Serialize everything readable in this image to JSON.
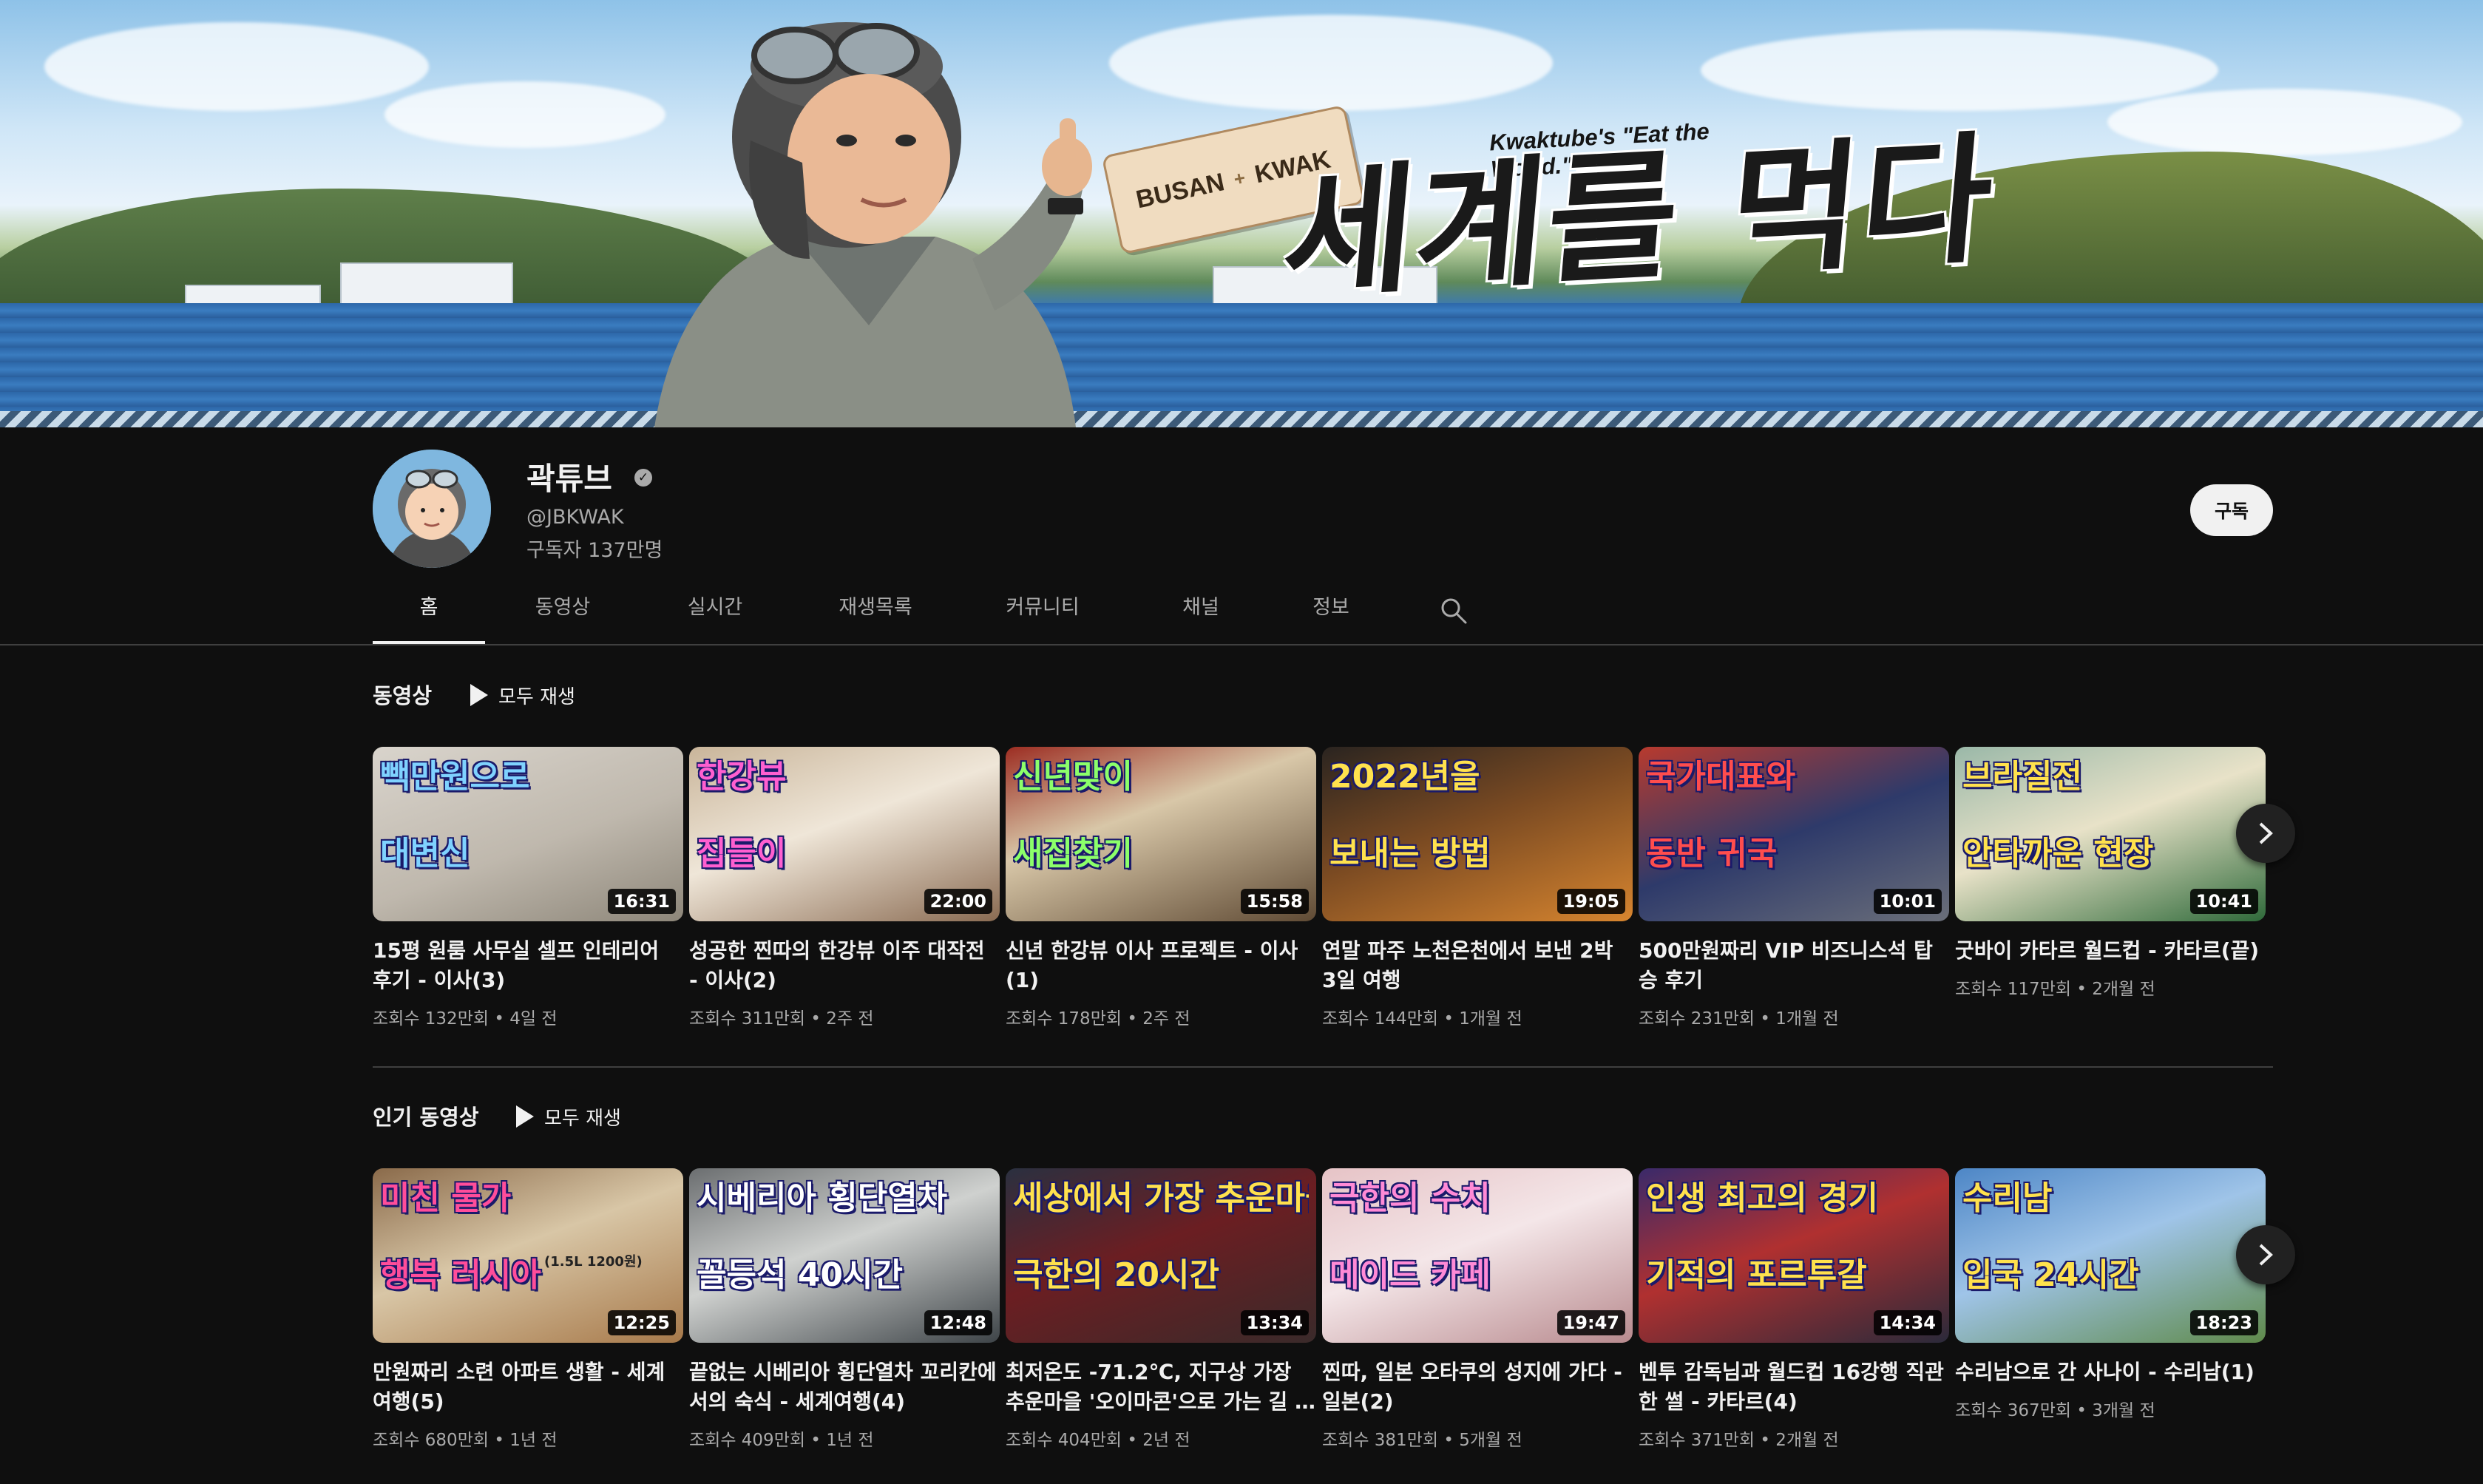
{
  "banner": {
    "tag_left": "BUSAN",
    "tag_plus": "+",
    "tag_right": "KWAK",
    "slogan": "Kwaktube's \"Eat the World.\"",
    "title": "세계를 먹다"
  },
  "channel": {
    "name": "곽튜브",
    "handle": "@JBKWAK",
    "subscribers": "구독자 137만명",
    "subscribe_label": "구독",
    "verified_glyph": "✓"
  },
  "tabs": [
    "홈",
    "동영상",
    "실시간",
    "재생목록",
    "커뮤니티",
    "채널",
    "정보"
  ],
  "sections": [
    {
      "title": "동영상",
      "play_all": "모두 재생",
      "videos": [
        {
          "title": "15평 원룸 사무실 셀프 인테리어 후기 - 이사(3)",
          "views": "조회수 132만회",
          "age": "4일 전",
          "duration": "16:31",
          "overlay": [
            "빽만원으로",
            "대변신"
          ]
        },
        {
          "title": "성공한 찐따의 한강뷰 이주 대작전 - 이사(2)",
          "views": "조회수 311만회",
          "age": "2주 전",
          "duration": "22:00",
          "overlay": [
            "한강뷰",
            "집들이"
          ]
        },
        {
          "title": "신년 한강뷰 이사 프로젝트 - 이사(1)",
          "views": "조회수 178만회",
          "age": "2주 전",
          "duration": "15:58",
          "overlay": [
            "신년맞이",
            "새집찾기"
          ]
        },
        {
          "title": "연말 파주 노천온천에서 보낸 2박 3일 여행",
          "views": "조회수 144만회",
          "age": "1개월 전",
          "duration": "19:05",
          "overlay": [
            "2022년을",
            "보내는 방법"
          ]
        },
        {
          "title": "500만원짜리 VIP 비즈니스석 탑승 후기",
          "views": "조회수 231만회",
          "age": "1개월 전",
          "duration": "10:01",
          "overlay": [
            "국가대표와",
            "동반 귀국"
          ]
        },
        {
          "title": "굿바이 카타르 월드컵 - 카타르(끝)",
          "views": "조회수 117만회",
          "age": "2개월 전",
          "duration": "10:41",
          "overlay": [
            "브라질전",
            "안타까운 현장"
          ]
        }
      ]
    },
    {
      "title": "인기 동영상",
      "play_all": "모두 재생",
      "videos": [
        {
          "title": "만원짜리 소련 아파트 생활 - 세계여행(5)",
          "views": "조회수 680만회",
          "age": "1년 전",
          "duration": "12:25",
          "overlay": [
            "미친 물가",
            "행복 러시아"
          ],
          "extra": "(1.5L 1200원)"
        },
        {
          "title": "끝없는 시베리아 횡단열차 꼬리칸에서의 숙식 - 세계여행(4)",
          "views": "조회수 409만회",
          "age": "1년 전",
          "duration": "12:48",
          "overlay": [
            "시베리아 횡단열차",
            "꼴등석 40시간"
          ]
        },
        {
          "title": "최저온도 -71.2℃, 지구상 가장 추운마을 '오이마콘'으로 가는 길 - ...",
          "views": "조회수 404만회",
          "age": "2년 전",
          "duration": "13:34",
          "overlay": [
            "세상에서 가장 추운마을",
            "극한의 20시간"
          ]
        },
        {
          "title": "찐따, 일본 오타쿠의 성지에 가다 - 일본(2)",
          "views": "조회수 381만회",
          "age": "5개월 전",
          "duration": "19:47",
          "overlay": [
            "극한의 수치",
            "메이드 카페"
          ]
        },
        {
          "title": "벤투 감독님과 월드컵 16강행 직관한 썰 - 카타르(4)",
          "views": "조회수 371만회",
          "age": "2개월 전",
          "duration": "14:34",
          "overlay": [
            "인생 최고의 경기",
            "기적의 포르투갈"
          ]
        },
        {
          "title": "수리남으로 간 사나이 - 수리남(1)",
          "views": "조회수 367만회",
          "age": "3개월 전",
          "duration": "18:23",
          "overlay": [
            "수리남",
            "입국 24시간"
          ]
        }
      ]
    }
  ],
  "meta_separator": "•",
  "colors": {
    "background": "#0f0f0f",
    "text_primary": "#f1f1f1",
    "text_secondary": "#aaaaaa",
    "divider": "#3f3f3f",
    "subscribe_bg": "#f1f1f1"
  },
  "icons": [
    "search-icon",
    "verified-icon",
    "play-icon",
    "chevron-right-icon"
  ]
}
